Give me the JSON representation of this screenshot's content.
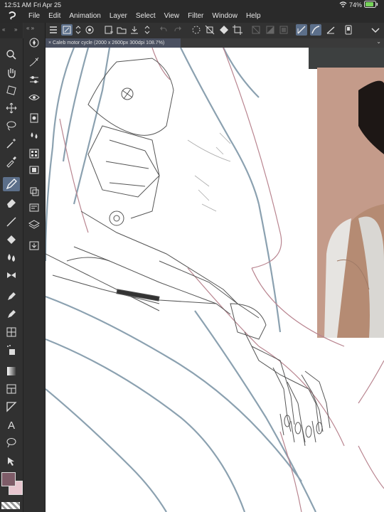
{
  "status_bar": {
    "time": "12:51 AM",
    "date": "Fri Apr 25",
    "battery": "74%"
  },
  "menu": {
    "items": [
      "File",
      "Edit",
      "Animation",
      "Layer",
      "Select",
      "View",
      "Filter",
      "Window",
      "Help"
    ]
  },
  "document": {
    "tab_title": "Caleb motor cycle (2000 x 2600px 300dpi 108.7%)"
  },
  "colors": {
    "main": "#7e5c68",
    "sub": "#e7c6cf",
    "accent": "#5c6f8a"
  },
  "icons": {
    "tools": [
      "zoom-icon",
      "hand-icon",
      "rotate-icon",
      "move-icon",
      "lasso-select-icon",
      "magic-wand-icon",
      "eyedropper-icon",
      "pen-icon",
      "eraser-icon",
      "line-icon",
      "fill-bucket-icon",
      "water-drop-icon",
      "ribbon-icon",
      "fountain-pen-icon",
      "brush-icon",
      "mesh-icon",
      "spray-icon",
      "gradient-icon",
      "frame-icon",
      "ruler-icon",
      "text-icon",
      "balloon-icon",
      "object-select-icon"
    ],
    "sub_tools": [
      "navigator-icon",
      "pen-pressure-icon",
      "sliders-icon",
      "eye-icon",
      "book-icon",
      "drops-icon",
      "grid-panel-icon",
      "filmstrip-icon",
      "layers-3d-icon",
      "layer-props-icon",
      "layers-icon",
      "import-icon"
    ]
  }
}
